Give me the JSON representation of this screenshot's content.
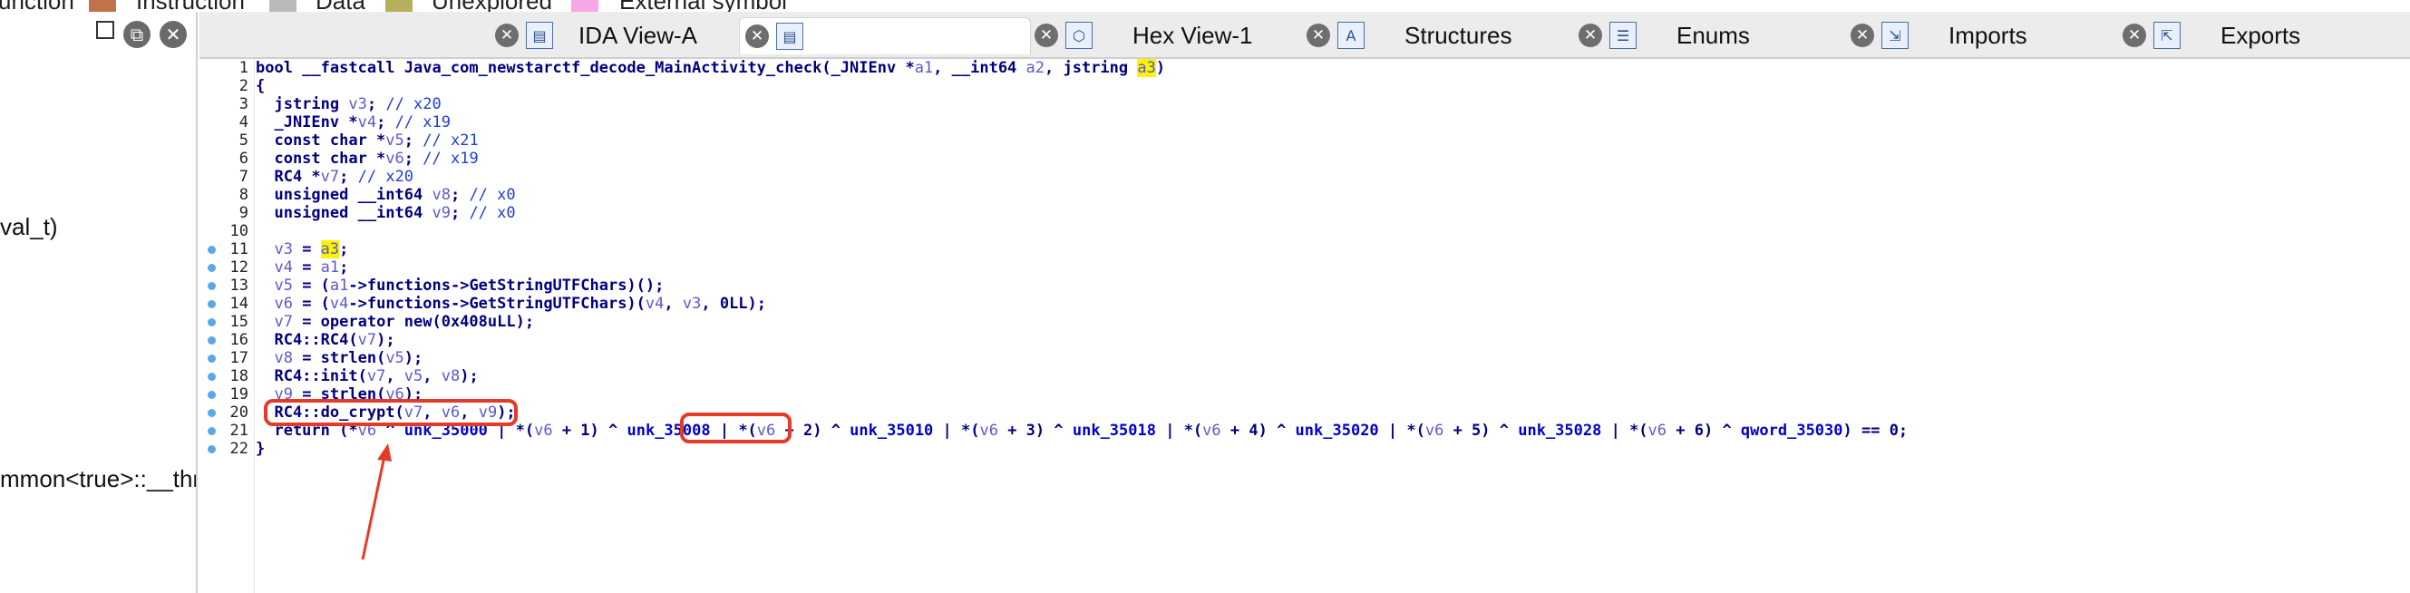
{
  "legend": [
    {
      "label": "unction",
      "color": "#ffffff"
    },
    {
      "label": "Instruction",
      "color": "#c0724a"
    },
    {
      "label": "Data",
      "color": "#b9b9b9"
    },
    {
      "label": "Unexplored",
      "color": "#b5b05a"
    },
    {
      "label": "External symbol",
      "color": "#f7a6e6"
    }
  ],
  "left_pane": {
    "fragments": [
      "val_t)",
      "mmon<true>::__thr"
    ]
  },
  "tabs": [
    {
      "label": "IDA View-A"
    },
    {
      "label": ""
    },
    {
      "label": "Hex View-1"
    },
    {
      "label": "Structures"
    },
    {
      "label": "Enums"
    },
    {
      "label": "Imports"
    },
    {
      "label": "Exports"
    }
  ],
  "editor": {
    "lines": [
      {
        "n": "1",
        "text": "bool __fastcall Java_com_newstarctf_decode_MainActivity_check(_JNIEnv *a1, __int64 a2, jstring a3)"
      },
      {
        "n": "2",
        "text": "{"
      },
      {
        "n": "3",
        "text": "  jstring v3; // x20"
      },
      {
        "n": "4",
        "text": "  _JNIEnv *v4; // x19"
      },
      {
        "n": "5",
        "text": "  const char *v5; // x21"
      },
      {
        "n": "6",
        "text": "  const char *v6; // x19"
      },
      {
        "n": "7",
        "text": "  RC4 *v7; // x20"
      },
      {
        "n": "8",
        "text": "  unsigned __int64 v8; // x0"
      },
      {
        "n": "9",
        "text": "  unsigned __int64 v9; // x0"
      },
      {
        "n": "10",
        "text": ""
      },
      {
        "n": "11",
        "text": "  v3 = a3;"
      },
      {
        "n": "12",
        "text": "  v4 = a1;"
      },
      {
        "n": "13",
        "text": "  v5 = (a1->functions->GetStringUTFChars)();"
      },
      {
        "n": "14",
        "text": "  v6 = (v4->functions->GetStringUTFChars)(v4, v3, 0LL);"
      },
      {
        "n": "15",
        "text": "  v7 = operator new(0x408uLL);"
      },
      {
        "n": "16",
        "text": "  RC4::RC4(v7);"
      },
      {
        "n": "17",
        "text": "  v8 = strlen(v5);"
      },
      {
        "n": "18",
        "text": "  RC4::init(v7, v5, v8);"
      },
      {
        "n": "19",
        "text": "  v9 = strlen(v6);"
      },
      {
        "n": "20",
        "text": "  RC4::do_crypt(v7, v6, v9);"
      },
      {
        "n": "21",
        "text": "  return (*v6 ^ unk_35000 | *(v6 + 1) ^ unk_35008 | *(v6 + 2) ^ unk_35010 | *(v6 + 3) ^ unk_35018 | *(v6 + 4) ^ unk_35020 | *(v6 + 5) ^ unk_35028 | *(v6 + 6) ^ qword_35030) == 0;"
      },
      {
        "n": "22",
        "text": "}"
      }
    ]
  },
  "colors": {
    "annotation": "#e53a2a",
    "highlight": "#fff200",
    "breakpoint_dot": "#5aa8e6"
  }
}
